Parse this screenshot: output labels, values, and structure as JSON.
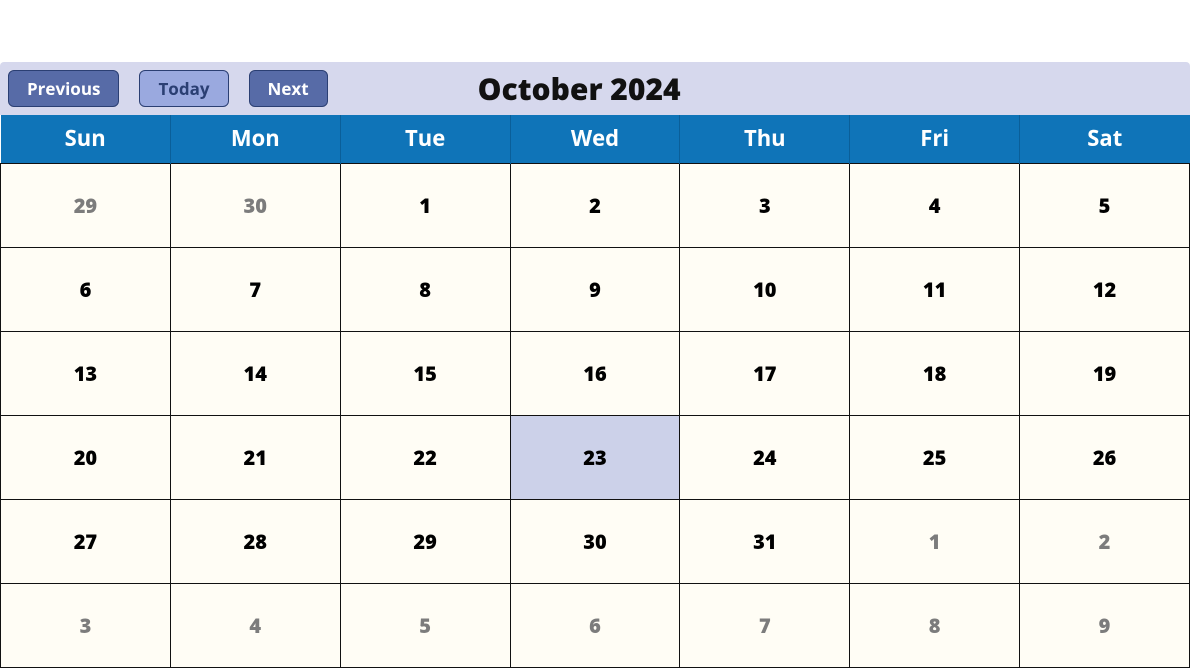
{
  "toolbar": {
    "prev_label": "Previous",
    "today_label": "Today",
    "next_label": "Next",
    "title": "October 2024"
  },
  "day_headers": [
    "Sun",
    "Mon",
    "Tue",
    "Wed",
    "Thu",
    "Fri",
    "Sat"
  ],
  "weeks": [
    [
      {
        "n": "29",
        "other": true
      },
      {
        "n": "30",
        "other": true
      },
      {
        "n": "1"
      },
      {
        "n": "2"
      },
      {
        "n": "3"
      },
      {
        "n": "4"
      },
      {
        "n": "5"
      }
    ],
    [
      {
        "n": "6"
      },
      {
        "n": "7"
      },
      {
        "n": "8"
      },
      {
        "n": "9"
      },
      {
        "n": "10"
      },
      {
        "n": "11"
      },
      {
        "n": "12"
      }
    ],
    [
      {
        "n": "13"
      },
      {
        "n": "14"
      },
      {
        "n": "15"
      },
      {
        "n": "16"
      },
      {
        "n": "17"
      },
      {
        "n": "18"
      },
      {
        "n": "19"
      }
    ],
    [
      {
        "n": "20"
      },
      {
        "n": "21"
      },
      {
        "n": "22"
      },
      {
        "n": "23",
        "today": true
      },
      {
        "n": "24"
      },
      {
        "n": "25"
      },
      {
        "n": "26"
      }
    ],
    [
      {
        "n": "27"
      },
      {
        "n": "28"
      },
      {
        "n": "29"
      },
      {
        "n": "30"
      },
      {
        "n": "31"
      },
      {
        "n": "1",
        "other": true
      },
      {
        "n": "2",
        "other": true
      }
    ],
    [
      {
        "n": "3",
        "other": true
      },
      {
        "n": "4",
        "other": true
      },
      {
        "n": "5",
        "other": true
      },
      {
        "n": "6",
        "other": true
      },
      {
        "n": "7",
        "other": true
      },
      {
        "n": "8",
        "other": true
      },
      {
        "n": "9",
        "other": true
      }
    ]
  ]
}
